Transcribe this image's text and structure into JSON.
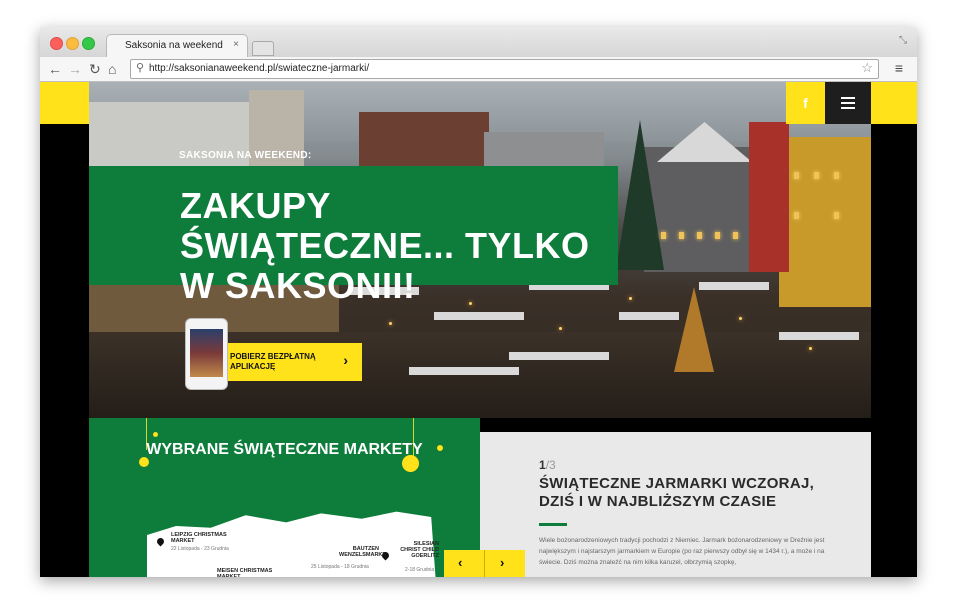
{
  "browser": {
    "tab_title": "Saksonia na weekend",
    "tab_close": "×",
    "url": "http://saksonianaweekend.pl/swiateczne-jarmarki/",
    "back": "←",
    "forward": "→",
    "reload": "↻",
    "home": "⌂",
    "search_icon": "⚲",
    "star": "☆",
    "menu": "≡",
    "resize": "⤡"
  },
  "header": {
    "facebook_label": "f"
  },
  "hero": {
    "kicker": "SAKSONIA NA WEEKEND:",
    "title": "ZAKUPY ŚWIĄTECZNE... TYLKO W SAKSONII!",
    "cta_label": "POBIERZ BEZPŁATNĄ APLIKACJĘ",
    "cta_arrow": "›"
  },
  "markets": {
    "title": "WYBRANE ŚWIĄTECZNE MARKETY",
    "items": [
      {
        "name": "LEIPZIG CHRISTMAS MARKET",
        "date": "22 Listopada - 23 Grudnia"
      },
      {
        "name": "BAUTZEN WENZELSMARKT",
        "date": "25 Listopada - 18 Grudnia"
      },
      {
        "name": "SILESIAN CHRIST CHILD GOERLITZ",
        "date": "2-18 Grudnia"
      },
      {
        "name": "MEISEN CHRISTMAS MARKET",
        "date": ""
      }
    ]
  },
  "article": {
    "counter_current": "1",
    "counter_total": "/3",
    "title": "ŚWIĄTECZNE JARMARKI WCZORAJ, DZIŚ I W NAJBLIŻSZYM CZASIE",
    "body": "Wiele bożonarodzeniowych tradycji pochodzi z Niemiec. Jarmark bożonarodzeniowy w Dreźnie jest największym i najstarszym jarmarkiem w Europie (po raz pierwszy odbył się w 1434 r.), a może i na świecie. Dziś można znaleźć na nim kilka karuzel, olbrzymią szopkę,",
    "prev": "‹",
    "next": "›"
  },
  "colors": {
    "brand_green": "#0e7d3c",
    "brand_yellow": "#ffe21a"
  }
}
